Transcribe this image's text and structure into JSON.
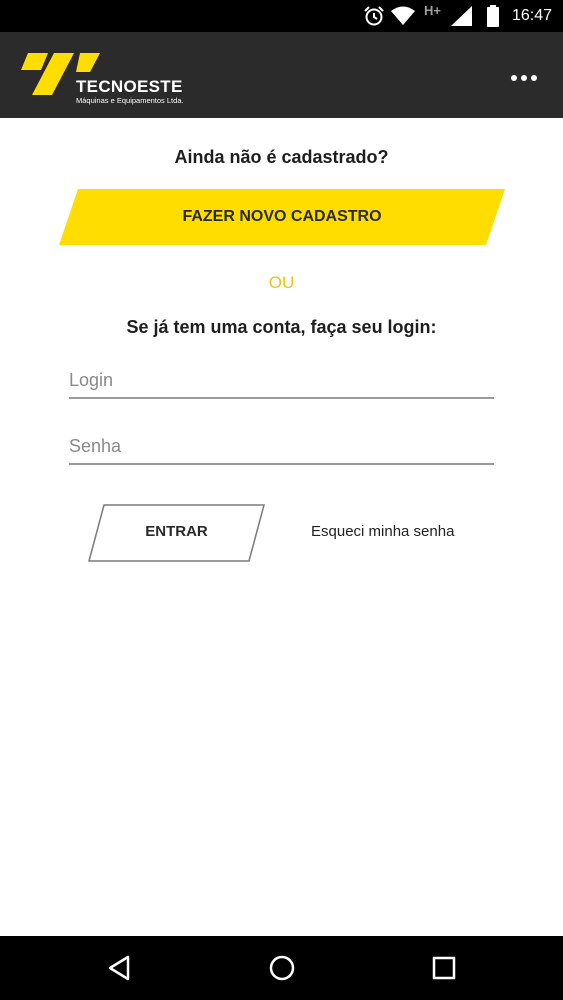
{
  "status_bar": {
    "time": "16:47",
    "network_type": "H+",
    "icons": [
      "alarm-icon",
      "wifi-icon",
      "cellular-signal-icon",
      "battery-icon"
    ]
  },
  "app_bar": {
    "logo": {
      "name": "TECNOESTE",
      "subtitle": "Máquinas e Equipamentos Ltda."
    },
    "menu_icon": "more-horizontal-icon"
  },
  "register": {
    "heading": "Ainda não é cadastrado?",
    "button_label": "FAZER NOVO CADASTRO"
  },
  "divider_text": "OU",
  "login": {
    "heading": "Se já tem uma conta, faça seu login:",
    "login_placeholder": "Login",
    "password_placeholder": "Senha",
    "submit_label": "ENTRAR",
    "forgot_label": "Esqueci minha senha"
  },
  "nav_bar": {
    "icons": [
      "back-triangle-icon",
      "home-circle-icon",
      "recents-square-icon"
    ]
  },
  "colors": {
    "accent_yellow": "#ffdd00",
    "app_bar_bg": "#2b2b2b",
    "or_text": "#f2c40f"
  }
}
